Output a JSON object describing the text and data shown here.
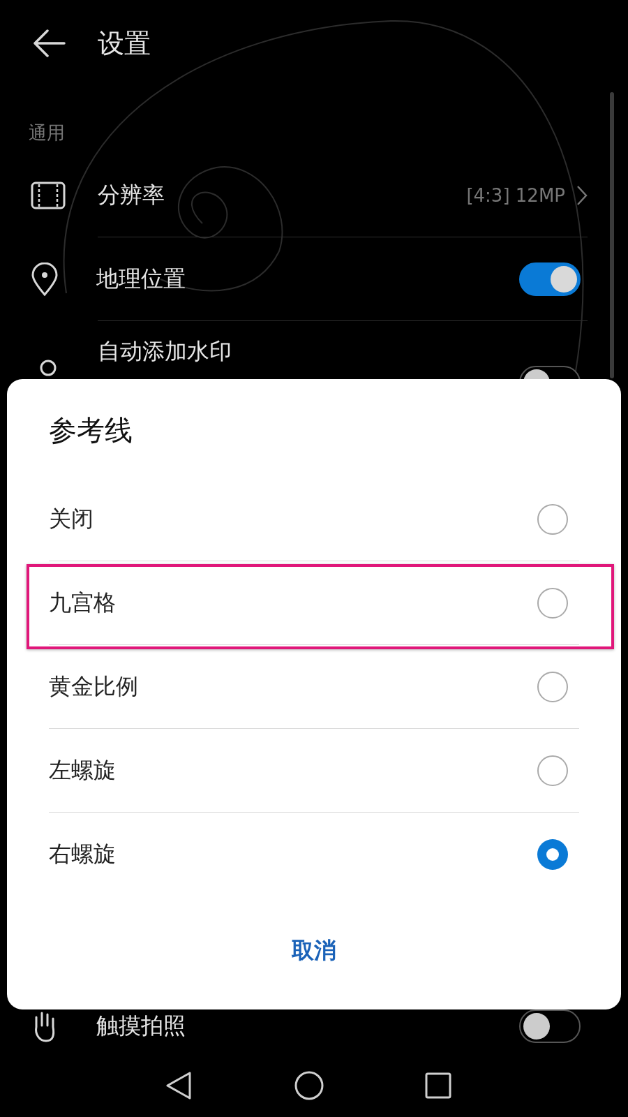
{
  "header": {
    "title": "设置"
  },
  "section": "通用",
  "settings": [
    {
      "kind": "link",
      "label": "分辨率",
      "value": "[4:3] 12MP"
    },
    {
      "kind": "toggle",
      "label": "地理位置",
      "on": true
    },
    {
      "kind": "toggle",
      "label": "自动添加水印",
      "on": false
    }
  ],
  "lower_settings": [
    {
      "kind": "toggle",
      "label": "触摸拍照",
      "on": false
    }
  ],
  "dialog": {
    "title": "参考线",
    "options": [
      {
        "label": "关闭",
        "selected": false,
        "highlighted": false
      },
      {
        "label": "九宫格",
        "selected": false,
        "highlighted": true
      },
      {
        "label": "黄金比例",
        "selected": false,
        "highlighted": false
      },
      {
        "label": "左螺旋",
        "selected": false,
        "highlighted": false
      },
      {
        "label": "右螺旋",
        "selected": true,
        "highlighted": false
      }
    ],
    "cancel": "取消"
  }
}
